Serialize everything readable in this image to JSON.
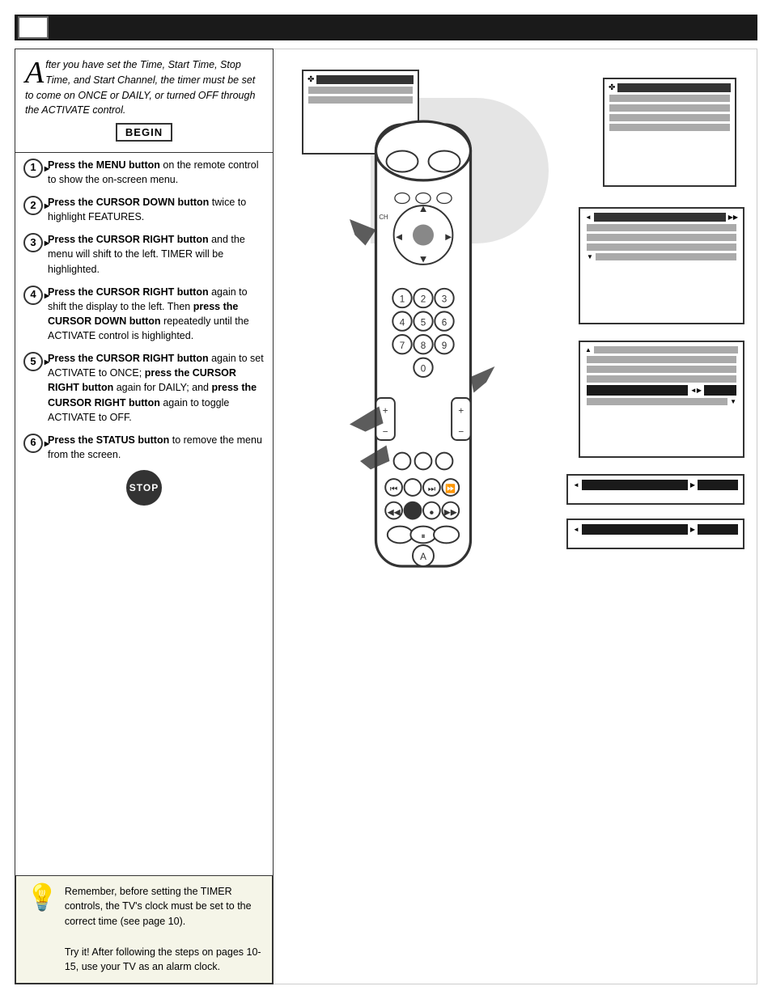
{
  "header": {
    "title": ""
  },
  "intro": {
    "drop_cap": "A",
    "text": "fter you have set the Time, Start Time, Stop Time, and Start Channel, the timer must be set to come on ONCE or DAILY, or turned OFF through the ACTIVATE control."
  },
  "begin_label": "BEGIN",
  "stop_label": "STOP",
  "steps": [
    {
      "num": "1",
      "text": "Press the MENU button on the remote control to show the on-screen menu."
    },
    {
      "num": "2",
      "text": "Press the CURSOR DOWN button twice to highlight FEATURES."
    },
    {
      "num": "3",
      "text": "Press the CURSOR RIGHT button and the menu will shift to the left. TIMER will be highlighted."
    },
    {
      "num": "4",
      "text": "Press the CURSOR RIGHT button again to shift the display to the left. Then press the CURSOR DOWN button repeatedly until the ACTIVATE control is highlighted."
    },
    {
      "num": "5",
      "text": "Press the CURSOR RIGHT button again to set ACTIVATE to ONCE; press the CURSOR RIGHT button again for DAILY; and press the CURSOR RIGHT button again to toggle ACTIVATE to OFF."
    },
    {
      "num": "6",
      "text": "Press the STATUS button to remove the menu from the screen."
    }
  ],
  "tip": {
    "text": "Remember, before setting the TIMER controls, the TV's clock must be set to the correct time (see page 10).\n\nTry it! After following the steps on pages 10-15, use your TV as an alarm clock."
  }
}
